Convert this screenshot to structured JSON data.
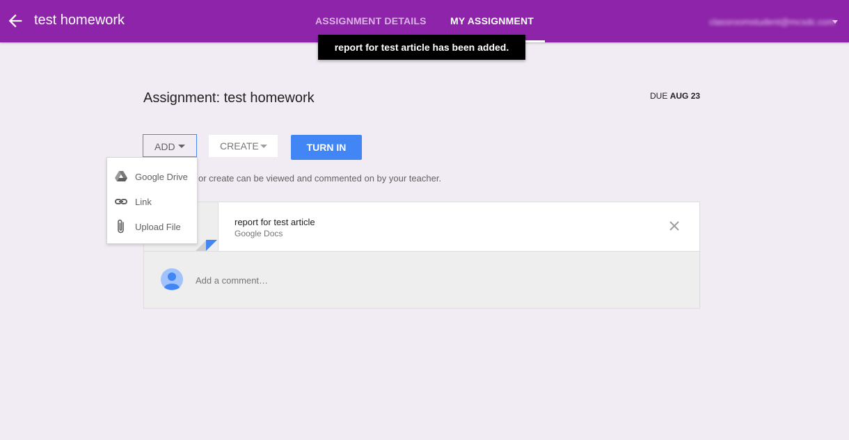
{
  "header": {
    "title": "test homework",
    "tabs": [
      {
        "label": "ASSIGNMENT DETAILS",
        "active": false
      },
      {
        "label": "MY ASSIGNMENT",
        "active": true
      }
    ],
    "account_label": "classroomstudent@mcsdc.com"
  },
  "toast": {
    "message": "report for test article has been added."
  },
  "assignment": {
    "title": "Assignment: test homework",
    "due_prefix": "DUE",
    "due_date": "AUG 23"
  },
  "toolbar": {
    "add_label": "ADD",
    "create_label": "CREATE",
    "turn_in_label": "TURN IN"
  },
  "helper_text": "or create can be viewed and commented on by your teacher.",
  "add_menu": {
    "items": [
      {
        "label": "Google Drive",
        "icon": "google-drive-icon"
      },
      {
        "label": "Link",
        "icon": "link-icon"
      },
      {
        "label": "Upload File",
        "icon": "paperclip-icon"
      }
    ]
  },
  "attachment": {
    "title": "report for test article",
    "type": "Google Docs"
  },
  "comment": {
    "placeholder": "Add a comment…"
  },
  "colors": {
    "header": "#8e24aa",
    "page_background": "#f1ebf3",
    "primary_button": "#4285f4",
    "toast_background": "#000000"
  }
}
